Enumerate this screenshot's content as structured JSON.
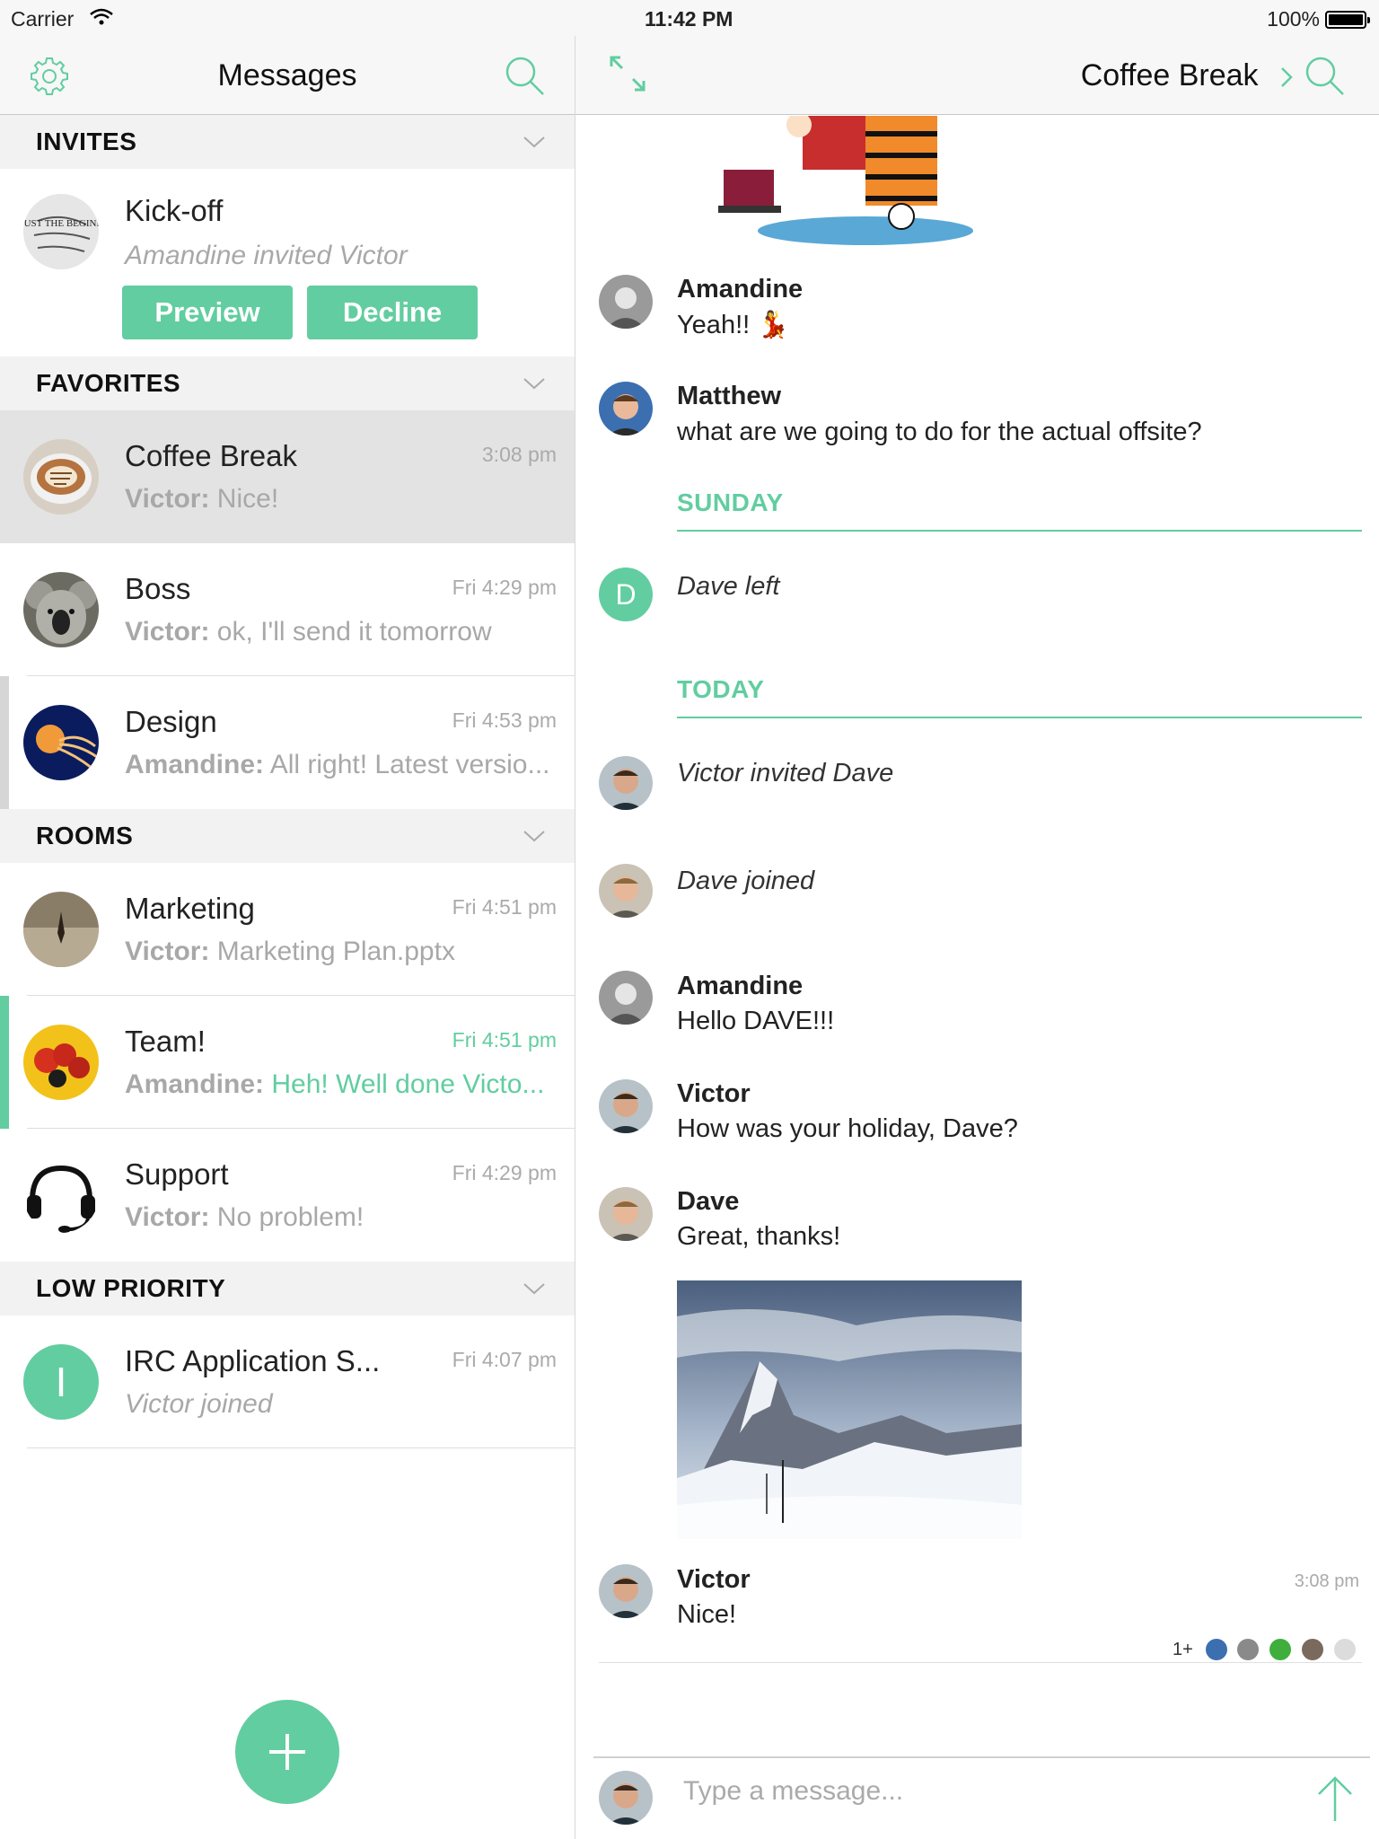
{
  "status_bar": {
    "carrier": "Carrier",
    "time": "11:42 PM",
    "battery": "100%"
  },
  "left_pane": {
    "title": "Messages",
    "sections": {
      "invites": "INVITES",
      "favorites": "FAVORITES",
      "rooms": "ROOMS",
      "low_priority": "LOW PRIORITY"
    },
    "invite": {
      "name": "Kick-off",
      "subtitle": "Amandine invited Victor",
      "preview_label": "Preview",
      "decline_label": "Decline",
      "avatar_text": "IT'S JUST THE BEGINNING"
    },
    "favorites": [
      {
        "name": "Coffee Break",
        "time": "3:08 pm",
        "sender": "Victor:",
        "text": " Nice!"
      },
      {
        "name": "Boss",
        "time": "Fri 4:29 pm",
        "sender": "Victor:",
        "text": " ok, I'll send it tomorrow"
      },
      {
        "name": "Design",
        "time": "Fri 4:53 pm",
        "sender": "Amandine:",
        "text": " All right! Latest versio..."
      }
    ],
    "rooms": [
      {
        "name": "Marketing",
        "time": "Fri 4:51 pm",
        "sender": "Victor:",
        "text": " Marketing Plan.pptx"
      },
      {
        "name": "Team!",
        "time": "Fri 4:51 pm",
        "sender": "Amandine:",
        "text": " Heh! Well done Victo..."
      },
      {
        "name": "Support",
        "time": "Fri 4:29 pm",
        "sender": "Victor:",
        "text": " No problem!"
      }
    ],
    "low_priority": [
      {
        "name": "IRC Application S...",
        "time": "Fri 4:07 pm",
        "text": "Victor joined",
        "avatar_letter": "I"
      }
    ]
  },
  "right_pane": {
    "title": "Coffee Break",
    "messages": [
      {
        "sender": "Amandine",
        "text": "Yeah!! 💃"
      },
      {
        "sender": "Matthew",
        "text": "what are we going to do for the actual offsite?"
      }
    ],
    "date_sunday": "SUNDAY",
    "event_dave_left": "Dave left",
    "dave_letter": "D",
    "date_today": "TODAY",
    "event_invited": "Victor invited Dave",
    "event_joined": "Dave joined",
    "messages_today": [
      {
        "sender": "Amandine",
        "text": "Hello DAVE!!!"
      },
      {
        "sender": "Victor",
        "text": "How was your holiday, Dave?"
      },
      {
        "sender": "Dave",
        "text": "Great, thanks!"
      }
    ],
    "last_message": {
      "sender": "Victor",
      "text": "Nice!",
      "time": "3:08 pm",
      "read_more": "1+"
    },
    "composer_placeholder": "Type a message..."
  },
  "colors": {
    "accent": "#62cda0",
    "section_bg": "#f2f2f2",
    "selected_bg": "#e3e3e3"
  }
}
